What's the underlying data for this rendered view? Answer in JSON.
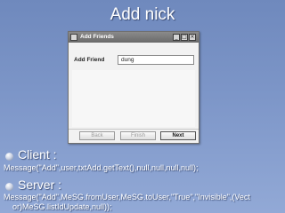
{
  "slide": {
    "title": "Add nick"
  },
  "dialog": {
    "title": "Add Friends",
    "field_label": "Add Friend",
    "field_value": "dung",
    "buttons": {
      "back": "Back",
      "finish": "Finish",
      "next": "Next"
    },
    "titlebar_buttons": {
      "minimize": "_",
      "maximize": "□",
      "close": "×"
    }
  },
  "client": {
    "heading": "Client :",
    "code": "Message(\"Add\",user,txtAdd.getText(),null,null,null,null);"
  },
  "server": {
    "heading": "Server :",
    "code_line1": "Message(\"Add\",MeSG.fromUser,MeSG.toUser,\"True\",\"Invisible\",(Vect",
    "code_line2": "or)MeSG.listIdUpdate,null));"
  },
  "colors": {
    "background_top": "#6f89bd",
    "background_bottom": "#92a9d6",
    "text": "#ffffff",
    "titlebar": "#7a7a7a"
  }
}
